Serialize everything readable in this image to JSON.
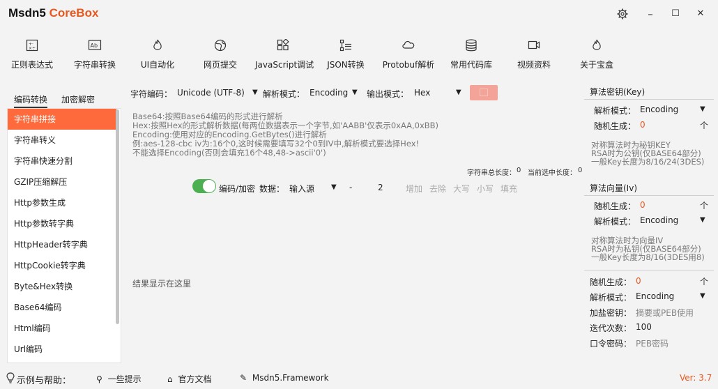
{
  "app": {
    "title_main": "Msdn5",
    "title_accent": "CoreBox"
  },
  "window": {
    "settings_icon": "gear-icon",
    "minimize": "–",
    "maximize": "☐",
    "close": "✕"
  },
  "toolbar": [
    {
      "label": "正则表达式",
      "icon": "regex-icon"
    },
    {
      "label": "字符串转换",
      "icon": "string-convert-icon"
    },
    {
      "label": "UI自动化",
      "icon": "flame-icon"
    },
    {
      "label": "网页提交",
      "icon": "globe-icon"
    },
    {
      "label": "JavaScript调试",
      "icon": "code-icon"
    },
    {
      "label": "JSON转换",
      "icon": "grid-icon"
    },
    {
      "label": "Protobuf解析",
      "icon": "tree-icon"
    },
    {
      "label": "常用代码库",
      "icon": "cloud-icon"
    },
    {
      "label": "视频资料",
      "icon": "database-icon"
    },
    {
      "label": "关于宝盒",
      "icon": "video-icon"
    }
  ],
  "side_tabs": [
    "编码转换",
    "加密解密"
  ],
  "sidebar": {
    "items": [
      "字符串拼接",
      "字符串转义",
      "字符串快速分割",
      "GZIP压缩解压",
      "Http参数生成",
      "Http参数转字典",
      "HttpHeader转字典",
      "HttpCookie转字典",
      "Byte&Hex转换",
      "Base64编码",
      "Html编码",
      "Url编码"
    ],
    "active_index": 0
  },
  "options": {
    "charset_label": "字符编码：",
    "charset_value": "Unicode (UTF-8)",
    "parse_label": "解析模式：",
    "parse_value": "Encoding",
    "output_label": "输出模式：",
    "output_value": "Hex"
  },
  "help_lines": [
    "Base64:按照Base64编码的形式进行解析",
    "Hex:按照Hex的形式解析数据(每两位数据表示一个字节,如'AABB'仅表示0xAA,0xBB)",
    "Encoding:使用对应的Encoding.GetBytes()进行解析",
    "例:aes-128-cbc  iv为:16个0,这时候需要填写32个0到IV中,解析模式要选择Hex!",
    "不能选择Encoding(否则会填充16个48,48->ascii'0')"
  ],
  "stats": {
    "total_label": "字符串总长度：",
    "total_value": "0",
    "sel_label": "当前选中长度：",
    "sel_value": "0"
  },
  "controls": {
    "toggle_label": "编码/加密",
    "data_label": "数据：",
    "source_value": "输入源",
    "dash": "-",
    "count": "2",
    "buttons": [
      "增加",
      "去除",
      "大写",
      "小写",
      "填充"
    ]
  },
  "result_placeholder": "结果显示在这里",
  "key_panel": {
    "title": "算法密钥(Key)",
    "parse_label": "解析模式：",
    "parse_value": "Encoding",
    "random_label": "随机生成：",
    "random_value": "0",
    "notes": [
      "对称算法时为秘钥KEY",
      "RSA时为公钥(仅BASE64部分)",
      "一般Key长度为8/16/24(3DES)"
    ]
  },
  "iv_panel": {
    "title": "算法向量(Iv)",
    "random_label": "随机生成：",
    "random_value": "0",
    "parse_label": "解析模式：",
    "parse_value": "Encoding",
    "notes": [
      "对称算法时为向量IV",
      "RSA时为私钥(仅BASE64部分)",
      "一般Key长度为8/16(3DES用8)"
    ]
  },
  "salt_panel": {
    "random_label": "随机生成：",
    "random_value": "0",
    "parse_label": "解析模式：",
    "parse_value": "Encoding",
    "salt_label": "加盐密钥：",
    "salt_placeholder": "摘要或PEB使用",
    "iter_label": "迭代次数：",
    "iter_value": "100",
    "pwd_label": "口令密码：",
    "pwd_placeholder": "PEB密码"
  },
  "bottom": {
    "help_label": "示例与帮助：",
    "links": [
      "一些提示",
      "官方文档",
      "Msdn5.Framework"
    ],
    "version": "Ver: 3.7"
  },
  "colors": {
    "accent": "#e8581e",
    "active_item": "#ff6a3c",
    "toggle_on": "#4caf50",
    "run_button": "#f4a398"
  }
}
